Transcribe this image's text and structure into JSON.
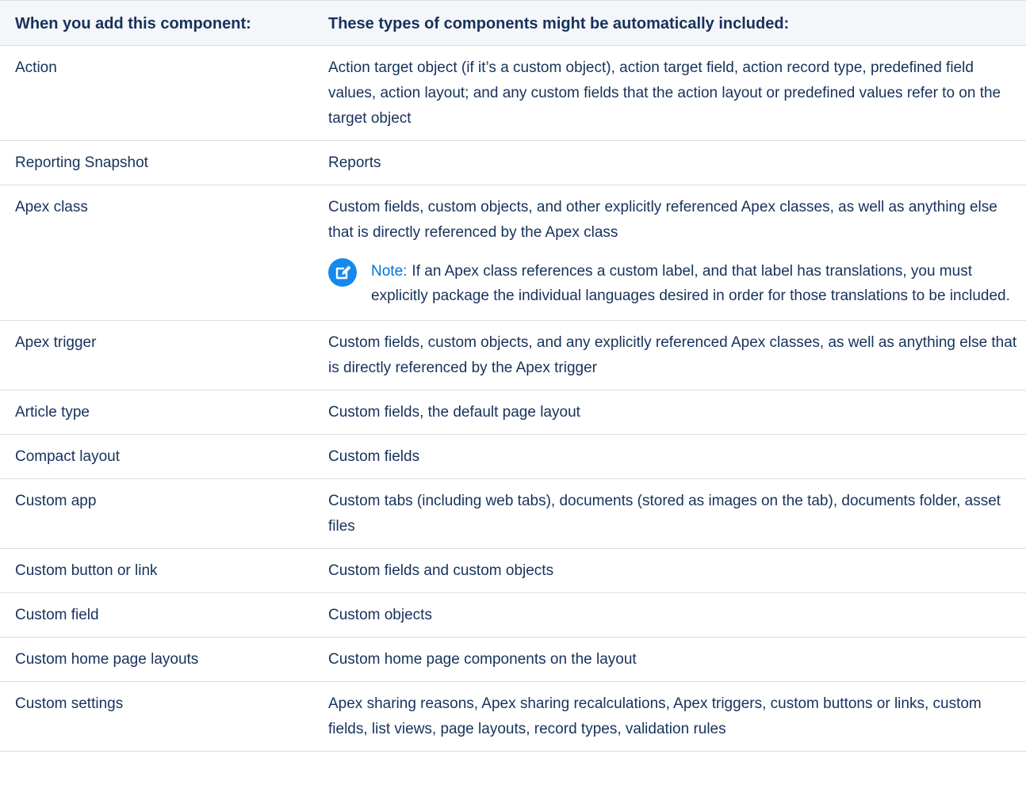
{
  "table": {
    "headers": {
      "col1": "When you add this component:",
      "col2": "These types of components might be automatically included:"
    },
    "rows": [
      {
        "component": "Action",
        "included": "Action target object (if it’s a custom object), action target field, action record type, predefined field values, action layout; and any custom fields that the action layout or predefined values refer to on the target object"
      },
      {
        "component": "Reporting Snapshot",
        "included": "Reports"
      },
      {
        "component": "Apex class",
        "included": "Custom fields, custom objects, and other explicitly referenced Apex classes, as well as anything else that is directly referenced by the Apex class",
        "note": {
          "label": "Note:",
          "text": "If an Apex class references a custom label, and that label has translations, you must explicitly package the individual languages desired in order for those translations to be included.",
          "icon": "edit-note-icon",
          "icon_color": "#1589ee"
        }
      },
      {
        "component": "Apex trigger",
        "included": "Custom fields, custom objects, and any explicitly referenced Apex classes, as well as anything else that is directly referenced by the Apex trigger"
      },
      {
        "component": "Article type",
        "included": "Custom fields, the default page layout"
      },
      {
        "component": "Compact layout",
        "included": "Custom fields"
      },
      {
        "component": "Custom app",
        "included": "Custom tabs (including web tabs), documents (stored as images on the tab), documents folder, asset files"
      },
      {
        "component": "Custom button or link",
        "included": "Custom fields and custom objects"
      },
      {
        "component": "Custom field",
        "included": "Custom objects"
      },
      {
        "component": "Custom home page layouts",
        "included": "Custom home page components on the layout"
      },
      {
        "component": "Custom settings",
        "included": "Apex sharing reasons, Apex sharing recalculations, Apex triggers, custom buttons or links, custom fields, list views, page layouts, record types, validation rules"
      }
    ]
  },
  "colors": {
    "text": "#16325c",
    "header_bg": "#f4f6f9",
    "border": "#d8dde6",
    "note_label": "#0070d2"
  }
}
